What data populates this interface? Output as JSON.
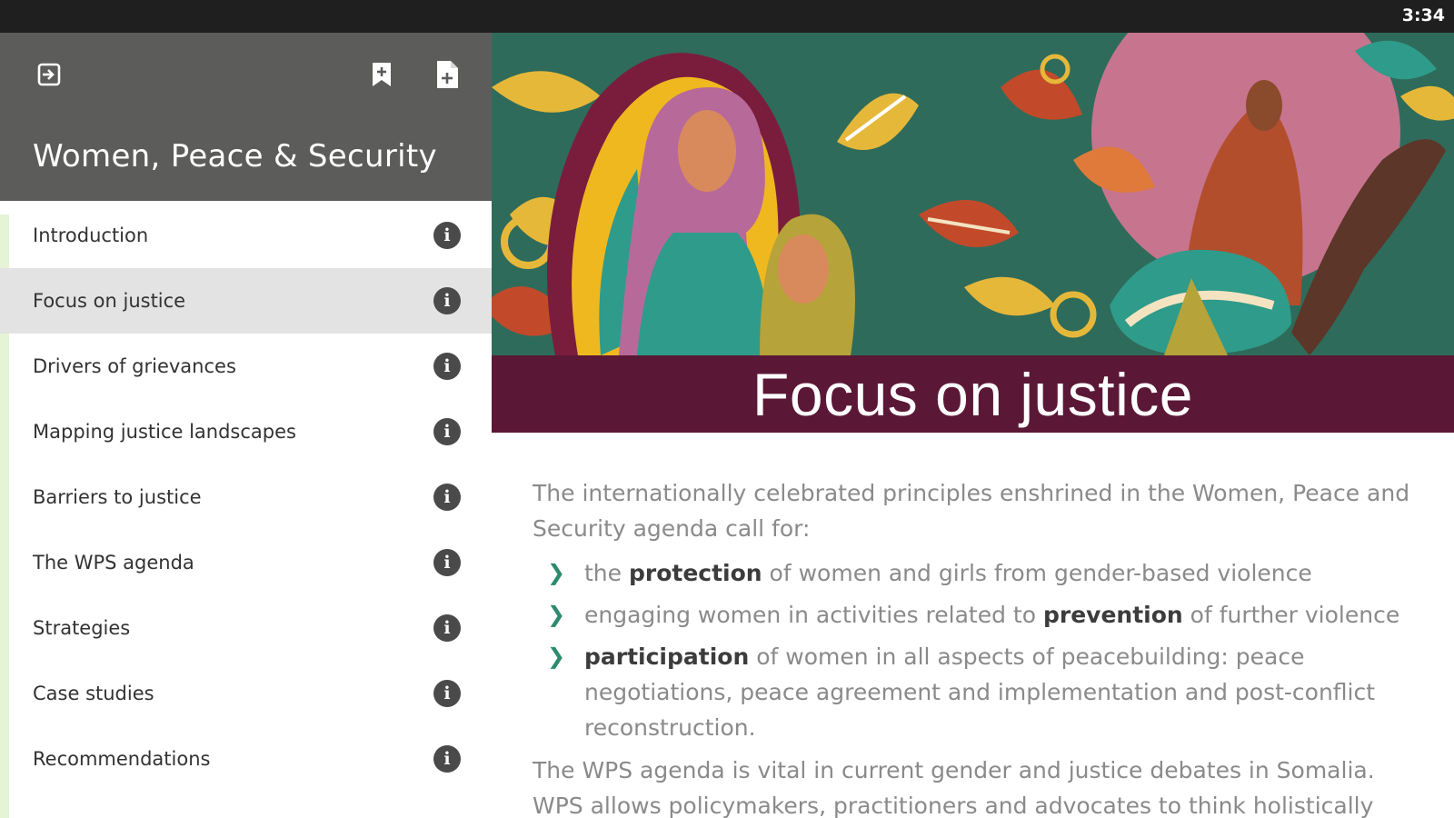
{
  "status_bar": {
    "time": "3:34"
  },
  "sidebar": {
    "title": "Women, Peace & Security",
    "items": [
      {
        "label": "Introduction",
        "active": false
      },
      {
        "label": "Focus on justice",
        "active": true
      },
      {
        "label": "Drivers of grievances",
        "active": false
      },
      {
        "label": "Mapping justice landscapes",
        "active": false
      },
      {
        "label": "Barriers to justice",
        "active": false
      },
      {
        "label": "The WPS agenda",
        "active": false
      },
      {
        "label": "Strategies",
        "active": false
      },
      {
        "label": "Case studies",
        "active": false
      },
      {
        "label": "Recommendations",
        "active": false
      }
    ]
  },
  "content": {
    "title": "Focus on justice",
    "intro": "The internationally celebrated principles enshrined in the Women, Peace and Security agenda call for:",
    "bullets": [
      {
        "pre": "the ",
        "strong": "protection",
        "post": " of women and girls from gender-based violence"
      },
      {
        "pre": "engaging women in activities related to ",
        "strong": "prevention",
        "post": " of further violence"
      },
      {
        "pre": "",
        "strong": "participation",
        "post": " of women in all aspects of peacebuilding: peace negotiations, peace agreement and implementation and post-conflict reconstruction."
      }
    ],
    "closing": "The WPS agenda is vital in current gender and justice debates in Somalia. WPS allows policymakers, practitioners and advocates to think holistically"
  },
  "colors": {
    "header_bg": "#5c5c5b",
    "active_item_bg": "#e3e3e3",
    "title_band": "#5b1836",
    "chevron": "#2e8a6e"
  }
}
